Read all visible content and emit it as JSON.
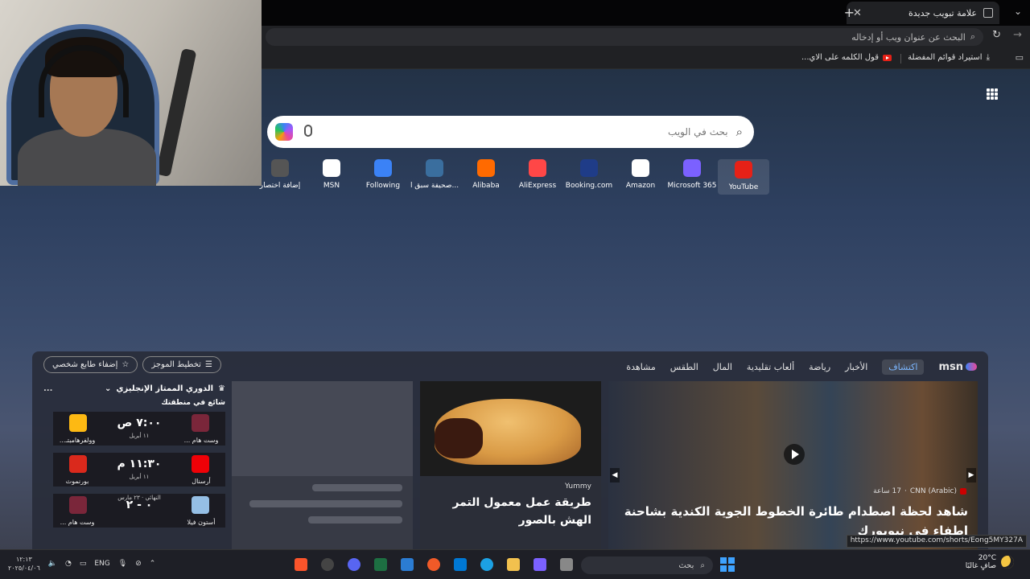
{
  "browser": {
    "tab_title": "علامة تبويب جديدة",
    "address_placeholder": "البحث عن عنوان ويب أو إدخاله",
    "favorites": {
      "import_label": "استيراد قوائم المفضلة",
      "yt_item_label": "قول الكلمه على الاي..."
    }
  },
  "ntp": {
    "search_placeholder": "بحث في الويب",
    "quicklinks": [
      {
        "label": "YouTube",
        "icon": "youtube-icon",
        "color": "#e62117"
      },
      {
        "label": "Microsoft 365",
        "icon": "m365-icon",
        "color": "#7b61ff"
      },
      {
        "label": "Amazon",
        "icon": "amazon-icon",
        "color": "#ffffff"
      },
      {
        "label": "Booking.com",
        "icon": "booking-icon",
        "color": "#1f3c88"
      },
      {
        "label": "AliExpress",
        "icon": "aliexpress-icon",
        "color": "#ff4747"
      },
      {
        "label": "Alibaba",
        "icon": "alibaba-icon",
        "color": "#ff6a00"
      },
      {
        "label": "صحيفة سبق ا...",
        "icon": "sabq-icon",
        "color": "#3a6e9e"
      },
      {
        "label": "Following",
        "icon": "following-icon",
        "color": "#3b82f6"
      },
      {
        "label": "MSN",
        "icon": "msn-icon",
        "color": "#ffffff"
      },
      {
        "label": "إضافة اختصار",
        "icon": "plus-icon",
        "color": "#555555"
      }
    ]
  },
  "feed": {
    "msn_label": "msn",
    "nav": [
      "اكتشاف",
      "الأخبار",
      "رياضة",
      "ألعاب تقليدية",
      "المال",
      "الطقس",
      "مشاهدة"
    ],
    "personalize_label": "إضفاء طابع شخصي",
    "layout_label": "تخطيط الموجز",
    "hero": {
      "source": "CNN (Arabic)",
      "age": "17 ساعة",
      "title": "شاهد لحظة اصطدام طائرة الخطوط الجوية الكندية بشاحنة إطفاء في نيويورك"
    },
    "food": {
      "source": "Yummy",
      "title": "طريقة عمل معمول التمر الهش بالصور"
    },
    "sports": {
      "league": "الدوري الممتاز الإنجليزي",
      "more": "...",
      "trending": "شائع في منطقتك",
      "matches": [
        {
          "home": "وست هام ...",
          "away": "وولفرهامبتـ...",
          "score": "٧:٠٠ ص",
          "date": "١١ أبريل",
          "home_color": "#7a263a",
          "away_color": "#fdb913",
          "tag": ""
        },
        {
          "home": "أرسنال",
          "away": "بورنموث",
          "score": "١١:٣٠ م",
          "date": "١١ أبريل",
          "home_color": "#ef0107",
          "away_color": "#da291c",
          "tag": ""
        },
        {
          "home": "أستون فيلا",
          "away": "وست هام ...",
          "score": "٠ - ٢",
          "date": "",
          "home_color": "#95bfe5",
          "away_color": "#7a263a",
          "tag": "النهائي · ٢٣ مارس"
        }
      ]
    }
  },
  "status_url": "https://www.youtube.com/shorts/Eong5MY327A",
  "taskbar": {
    "search_label": "بحث",
    "temp": "20°C",
    "weather_desc": "صافٍ غالبًا",
    "lang": "ENG",
    "time": "١٢:١٣",
    "date": "٢٠٢٥/٠٤/٠٦"
  }
}
